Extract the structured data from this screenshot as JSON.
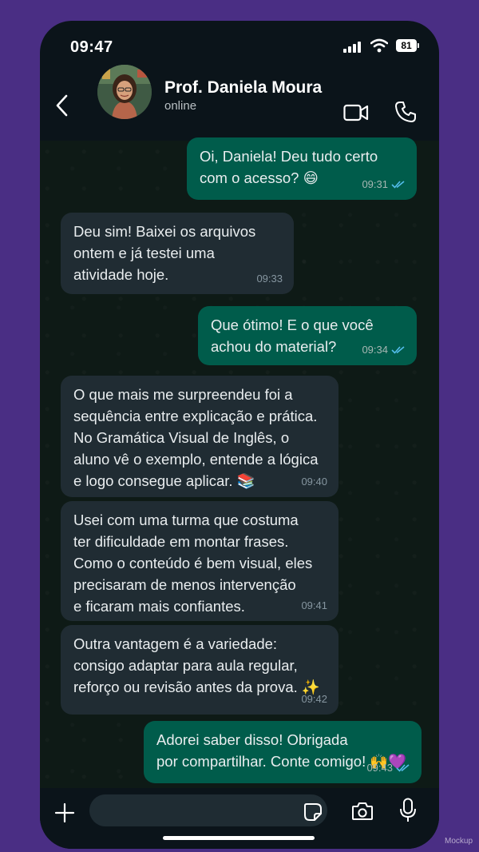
{
  "status_bar": {
    "time": "09:47",
    "battery": "81"
  },
  "header": {
    "contact_name": "Prof. Daniela Moura",
    "contact_status": "online"
  },
  "messages": [
    {
      "direction": "out",
      "text": "Oi, Daniela! Deu tudo certo\ncom o acesso? 😄",
      "time": "09:31",
      "read": true
    },
    {
      "direction": "in",
      "text": "Deu sim! Baixei os arquivos\nontem e já testei uma\natividade hoje.",
      "time": "09:33"
    },
    {
      "direction": "out",
      "text": "Que ótimo! E o que você\nachou do material?",
      "time": "09:34",
      "read": true
    },
    {
      "direction": "in",
      "text": "O que mais me surpreendeu foi a\nsequência entre explicação e prática.\nNo Gramática Visual de Inglês, o\naluno vê o exemplo, entende a lógica\ne logo consegue aplicar. 📚",
      "time": "09:40"
    },
    {
      "direction": "in",
      "text": "Usei com uma turma que costuma\nter dificuldade em montar frases.\nComo o conteúdo é bem visual, eles\nprecisaram de menos intervenção\ne ficaram mais confiantes.",
      "time": "09:41"
    },
    {
      "direction": "in",
      "text": "Outra vantagem é a variedade:\nconsigo adaptar para aula regular,\nreforço ou revisão antes da prova. ✨",
      "time": "09:42"
    },
    {
      "direction": "out",
      "text": "Adorei saber disso! Obrigada\npor compartilhar. Conte comigo! 🙌💜",
      "time": "09:43",
      "read": true
    }
  ],
  "colors": {
    "outgoing_bubble": "#005c4b",
    "incoming_bubble": "#202c33",
    "read_tick": "#53bdeb",
    "background": "#4a2e84"
  },
  "watermark": "Mockup"
}
